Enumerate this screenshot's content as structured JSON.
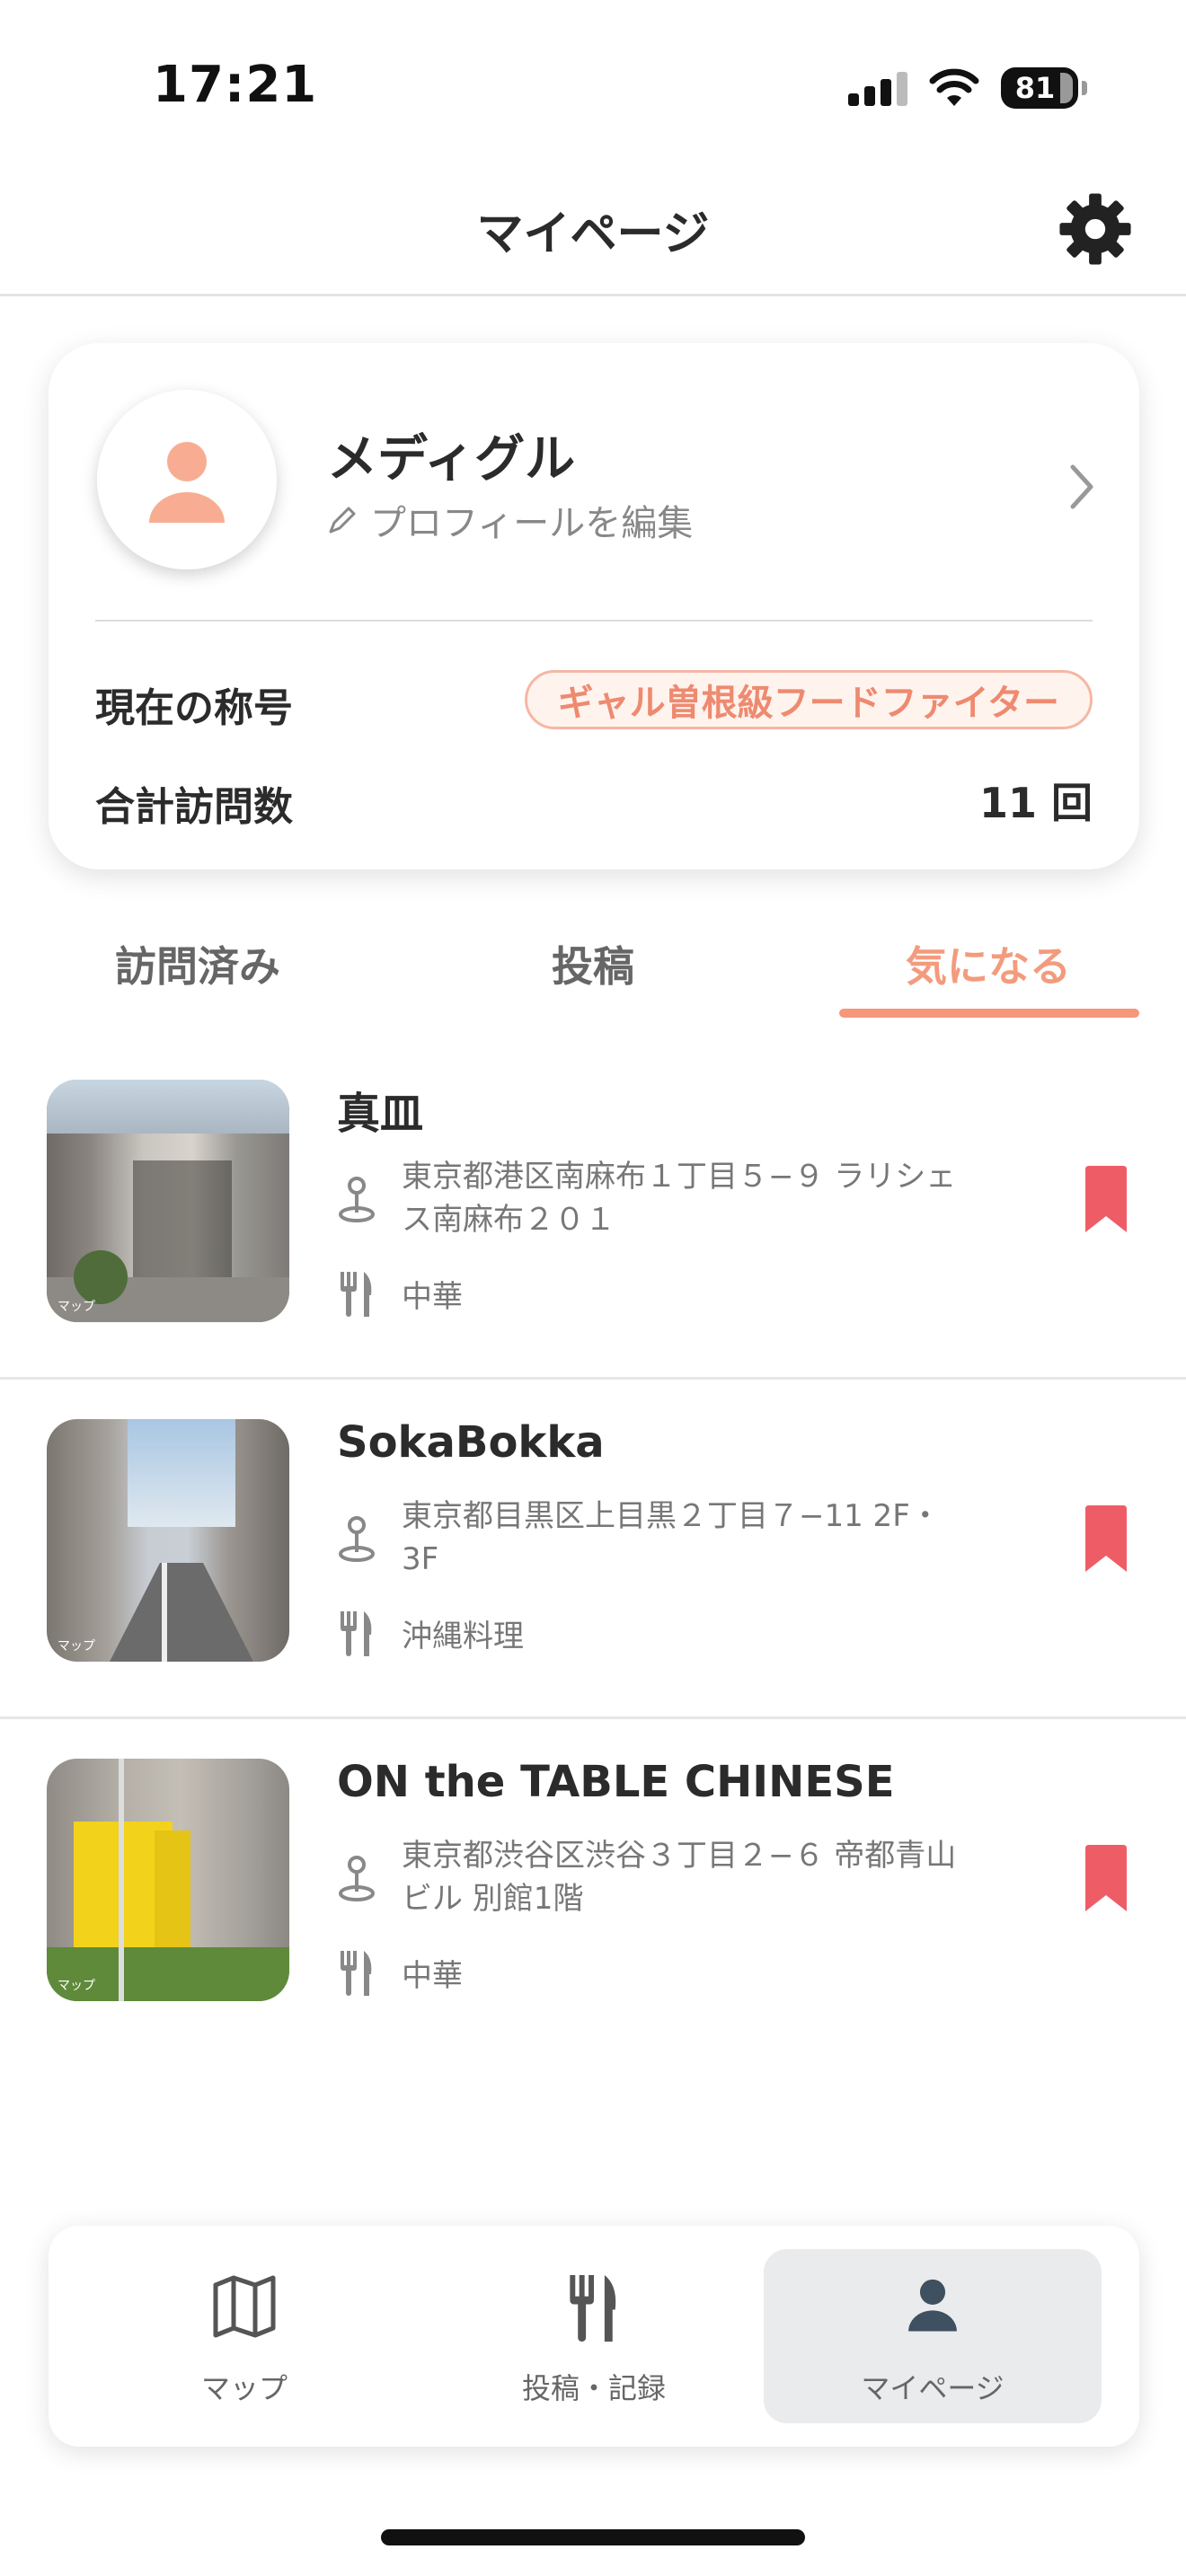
{
  "status": {
    "time": "17:21",
    "battery": "81"
  },
  "header": {
    "title": "マイページ"
  },
  "profile": {
    "name": "メディグル",
    "edit_label": "プロフィールを編集",
    "title_label": "現在の称号",
    "title_value": "ギャル曽根級フードファイター",
    "visits_label": "合計訪問数",
    "visits_value": "11 回"
  },
  "tabs": [
    {
      "label": "訪問済み",
      "active": false
    },
    {
      "label": "投稿",
      "active": false
    },
    {
      "label": "気になる",
      "active": true
    }
  ],
  "items": [
    {
      "name": "真皿",
      "address": "東京都港区南麻布１丁目５−９ ラリシェス南麻布２０１",
      "category": "中華",
      "bookmarked": true
    },
    {
      "name": "SokaBokka",
      "address": "東京都目黒区上目黒２丁目７−11 2F・3F",
      "category": "沖縄料理",
      "bookmarked": true
    },
    {
      "name": "ON the TABLE CHINESE",
      "address": "東京都渋谷区渋谷３丁目２−６ 帝都青山ビル 別館1階",
      "category": "中華",
      "bookmarked": true
    }
  ],
  "nav": [
    {
      "label": "マップ",
      "icon": "map-icon",
      "active": false
    },
    {
      "label": "投稿・記録",
      "icon": "fork-knife-icon",
      "active": false
    },
    {
      "label": "マイページ",
      "icon": "person-icon",
      "active": true
    }
  ],
  "colors": {
    "accent": "#f39b7d",
    "bookmark": "#ee5d66",
    "avatar": "#f8ad93"
  }
}
